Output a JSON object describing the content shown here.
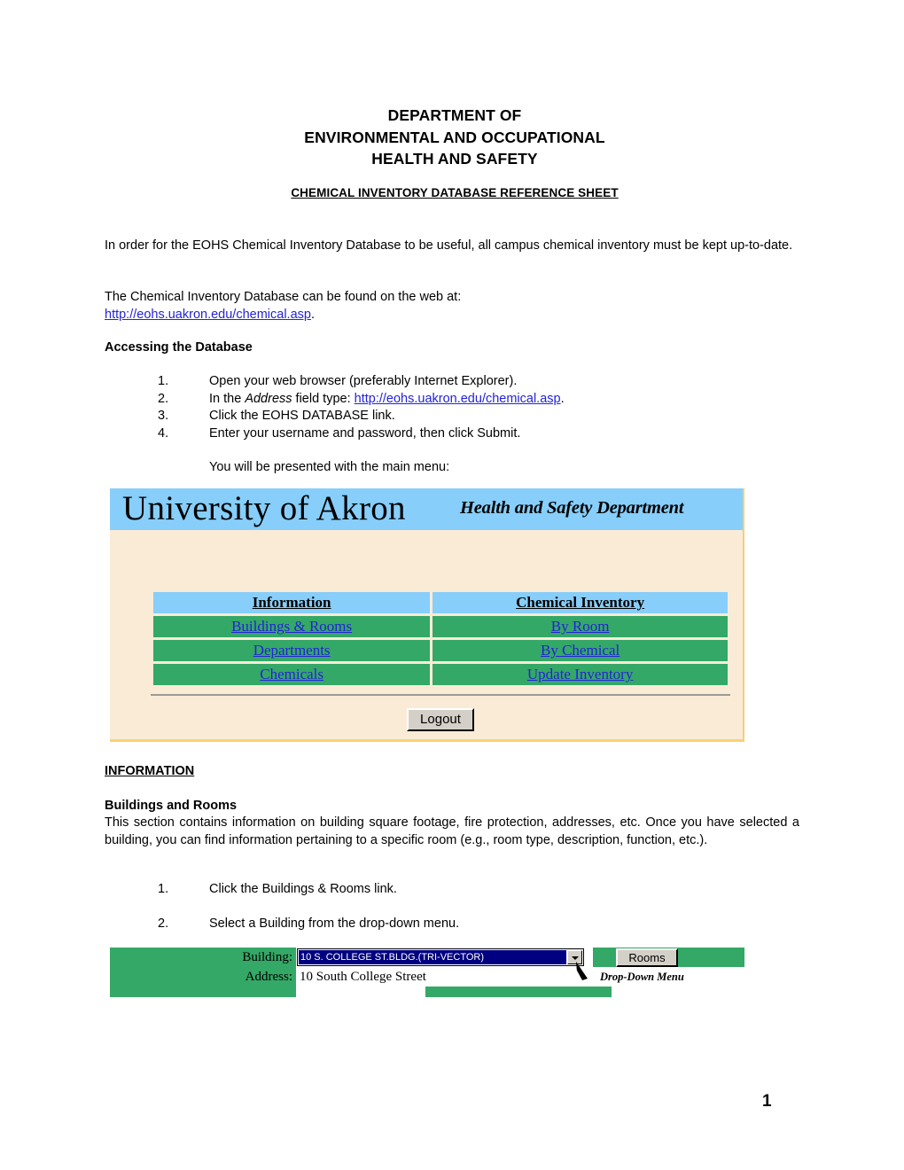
{
  "document": {
    "title_lines": [
      "DEPARTMENT OF",
      "ENVIRONMENTAL AND OCCUPATIONAL",
      "HEALTH AND SAFETY"
    ],
    "subtitle": "CHEMICAL INVENTORY DATABASE REFERENCE SHEET",
    "page_number": "1"
  },
  "intro": {
    "paragraph1": "In order for the EOHS Chemical Inventory Database to be useful, all campus chemical inventory must be kept up-to-date.",
    "paragraph2_lead": "The Chemical Inventory Database can be found on the web at:",
    "url": "http://eohs.uakron.edu/chemical.asp",
    "url_period": "."
  },
  "accessing": {
    "heading": "Accessing the Database",
    "steps": [
      {
        "num": "1.",
        "text": "Open your web browser (preferably Internet Explorer)."
      },
      {
        "num": "2.",
        "text_before": "In the ",
        "emphasis": "Address",
        "text_after": " field type:  ",
        "link": "http://eohs.uakron.edu/chemical.asp",
        "trailing": "."
      },
      {
        "num": "3.",
        "text": "Click the EOHS DATABASE link."
      },
      {
        "num": "4.",
        "text": "Enter your username and password, then click Submit."
      }
    ],
    "note": "You will be presented with the main menu:"
  },
  "main_menu_screenshot": {
    "banner": {
      "university": "University of Akron",
      "department": "Health and Safety Department",
      "background_color": "#87CEFA"
    },
    "body_background_color": "#FAEBD7",
    "table": {
      "headers": [
        "Information",
        "Chemical Inventory"
      ],
      "rows": [
        {
          "information": "Buildings & Rooms",
          "chemical_inventory": "By Room"
        },
        {
          "information": "Departments",
          "chemical_inventory": "By Chemical"
        },
        {
          "information": "Chemicals",
          "chemical_inventory": "Update Inventory"
        }
      ],
      "header_color": "#87CEFA",
      "cell_color": "#34A866",
      "link_color": "#2323D8"
    },
    "logout_button": "Logout"
  },
  "information_section": {
    "heading": "INFORMATION",
    "subheading": "Buildings and Rooms",
    "body": "This section contains information on building square footage, fire protection, addresses, etc.  Once you have selected a building, you can find information pertaining to a specific room (e.g., room type, description, function, etc.).",
    "steps": [
      {
        "num": "1.",
        "text": "Click the Buildings & Rooms link."
      },
      {
        "num": "2.",
        "text": "Select a Building from the drop-down menu."
      }
    ]
  },
  "building_screenshot": {
    "building_label": "Building:",
    "building_selected": "10 S. COLLEGE ST.BLDG.(TRI-VECTOR)",
    "address_label": "Address:",
    "address_value": "10 South College Street",
    "rooms_button": "Rooms",
    "callout": "Drop-Down Menu",
    "green_color": "#34A866",
    "selection_color": "#000080"
  }
}
